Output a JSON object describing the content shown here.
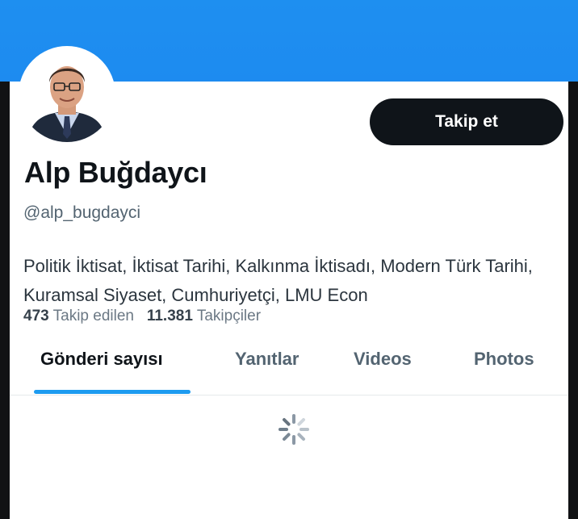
{
  "profile": {
    "name": "Alp Buğdaycı",
    "handle": "@alp_bugdayci",
    "bio": "Politik İktisat, İktisat Tarihi, Kalkınma İktisadı, Modern Türk Tarihi, Kuramsal Siyaset, Cumhuriyetçi, LMU Econ",
    "following_count": "473",
    "following_label": "Takip edilen",
    "followers_count": "11.381",
    "followers_label": "Takipçiler"
  },
  "actions": {
    "follow_label": "Takip et"
  },
  "tabs": [
    {
      "label": "Gönderi sayısı",
      "active": true
    },
    {
      "label": "Yanıtlar",
      "active": false
    },
    {
      "label": "Videos",
      "active": false
    },
    {
      "label": "Photos",
      "active": false
    }
  ],
  "colors": {
    "banner": "#1d8bf0",
    "accent": "#1d9bf0",
    "button": "#0f1419"
  },
  "icons": {
    "loading": "loading-spinner-icon"
  }
}
